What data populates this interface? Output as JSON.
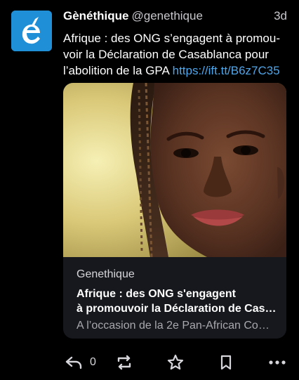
{
  "tweet": {
    "display_name": "Gènéthique",
    "handle": "@genethique",
    "time": "3d",
    "text_lines": [
      "Afrique : des ONG s’engagent à promou-",
      "voir la Déclaration de Casablanca pour",
      "l’abolition de la GPA "
    ],
    "link": "https://ift.tt/B6z7C35"
  },
  "card": {
    "domain": "Genethique",
    "title_lines": [
      "Afrique : des ONG s'engagent",
      "à promouvoir la Déclaration de Casa…"
    ],
    "description": "A l’occasion de la 2e Pan-African Co…",
    "image_icon": "portrait-photo"
  },
  "actions": {
    "reply_count": "0",
    "icons": [
      "reply-icon",
      "retweet-icon",
      "star-icon",
      "bookmark-icon",
      "more-icon"
    ]
  },
  "colors": {
    "background": "#000000",
    "link": "#4ea6ea",
    "avatar": "#1f8fd8",
    "card": "#16181d"
  }
}
